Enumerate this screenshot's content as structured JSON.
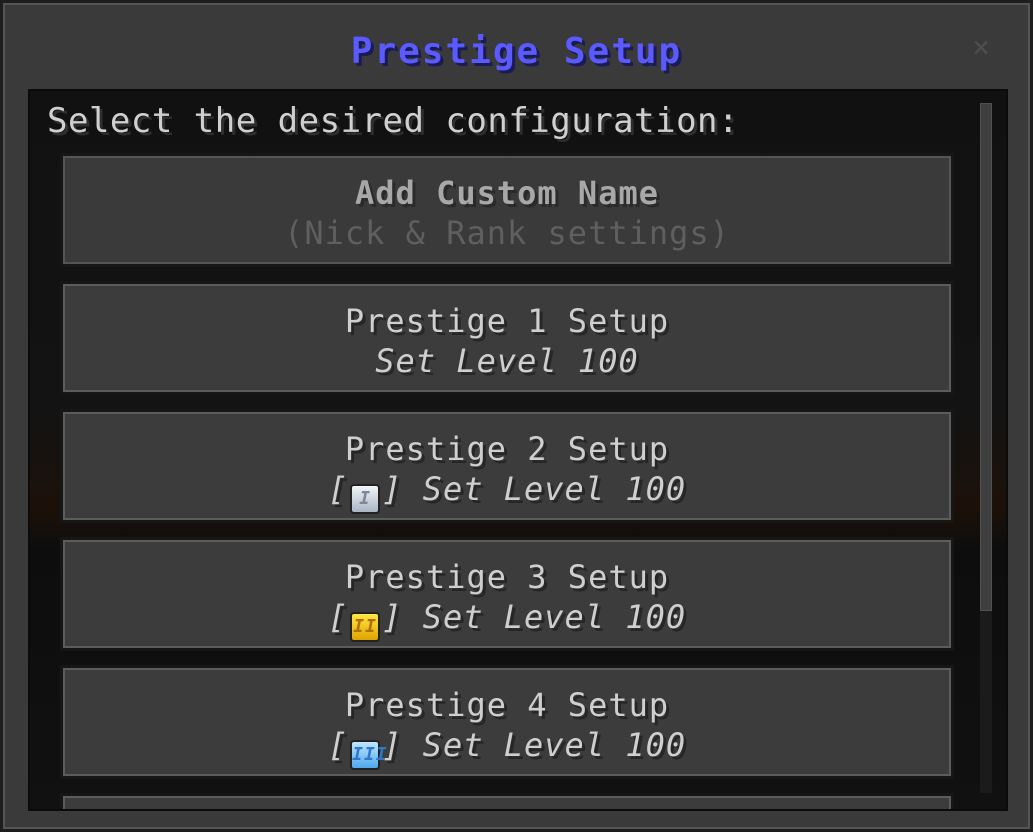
{
  "dialog": {
    "title": "Prestige Setup",
    "title_color": "#5a5aff",
    "close_icon": "×",
    "prompt": "Select the desired configuration:"
  },
  "options": [
    {
      "title": "Add Custom Name",
      "subtitle": "(Nick & Rank settings)",
      "badge": null,
      "state": "disabled"
    },
    {
      "title": "Prestige 1 Setup",
      "subtitle": "Set Level 100",
      "badge": null,
      "state": "enabled"
    },
    {
      "title": "Prestige 2 Setup",
      "subtitle": "Set Level 100",
      "badge": {
        "icon": "prestige-2-badge-icon",
        "glyph": "I",
        "color": "silver"
      },
      "state": "enabled"
    },
    {
      "title": "Prestige 3 Setup",
      "subtitle": "Set Level 100",
      "badge": {
        "icon": "prestige-3-badge-icon",
        "glyph": "II",
        "color": "gold"
      },
      "state": "enabled"
    },
    {
      "title": "Prestige 4 Setup",
      "subtitle": "Set Level 100",
      "badge": {
        "icon": "prestige-4-badge-icon",
        "glyph": "III",
        "color": "blue"
      },
      "state": "enabled"
    }
  ],
  "bracket_open": "[",
  "bracket_close": "]",
  "scrollbar": {
    "icon": "scrollbar"
  }
}
